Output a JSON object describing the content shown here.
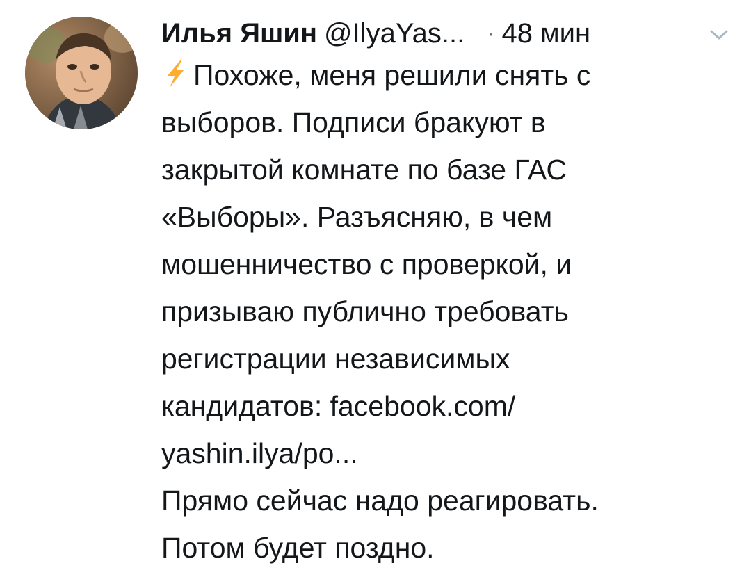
{
  "tweet": {
    "author_name": "Илья Яшин",
    "author_handle": "@IlyaYas...",
    "separator": "·",
    "time": "48 мин",
    "avatar_icon": "user-avatar",
    "menu_icon": "chevron-down-icon",
    "lead_icon": "lightning-bolt-icon",
    "lines": [
      "Похоже, меня решили снять с",
      "выборов. Подписи бракуют в",
      "закрытой комнате по базе ГАС",
      "«Выборы». Разъясняю, в чем",
      "мошенничество с проверкой, и",
      "призываю публично требовать",
      "регистрации независимых",
      "кандидатов: facebook.com/",
      "yashin.ilya/po...",
      "Прямо сейчас надо реагировать.",
      "Потом будет поздно."
    ]
  },
  "colors": {
    "text": "#14171a",
    "muted": "#657786",
    "bolt": "#ffac33",
    "background": "#ffffff"
  }
}
